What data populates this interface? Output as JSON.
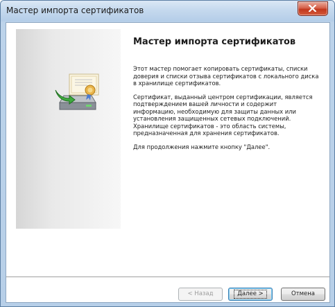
{
  "window": {
    "title": "Мастер импорта сертификатов",
    "close_icon": "close-x-icon"
  },
  "wizard": {
    "icon": "certificate-import-icon",
    "heading": "Мастер импорта сертификатов",
    "paragraphs": [
      "Этот мастер помогает копировать сертификаты, списки доверия и списки отзыва сертификатов с локального диска в хранилище сертификатов.",
      "Сертификат, выданный центром сертификации, является подтверждением вашей личности и содержит информацию, необходимую для защиты данных или установления защищенных сетевых подключений. Хранилище сертификатов - это область системы, предназначенная для хранения сертификатов.",
      "Для продолжения нажмите кнопку \"Далее\"."
    ]
  },
  "buttons": {
    "back_label": "< Назад",
    "next_label": "Далее >",
    "cancel_label": "Отмена"
  },
  "colors": {
    "title_bar": "#c5d9ee",
    "close_button": "#c2381d",
    "default_button_border": "#3c7fb1"
  }
}
